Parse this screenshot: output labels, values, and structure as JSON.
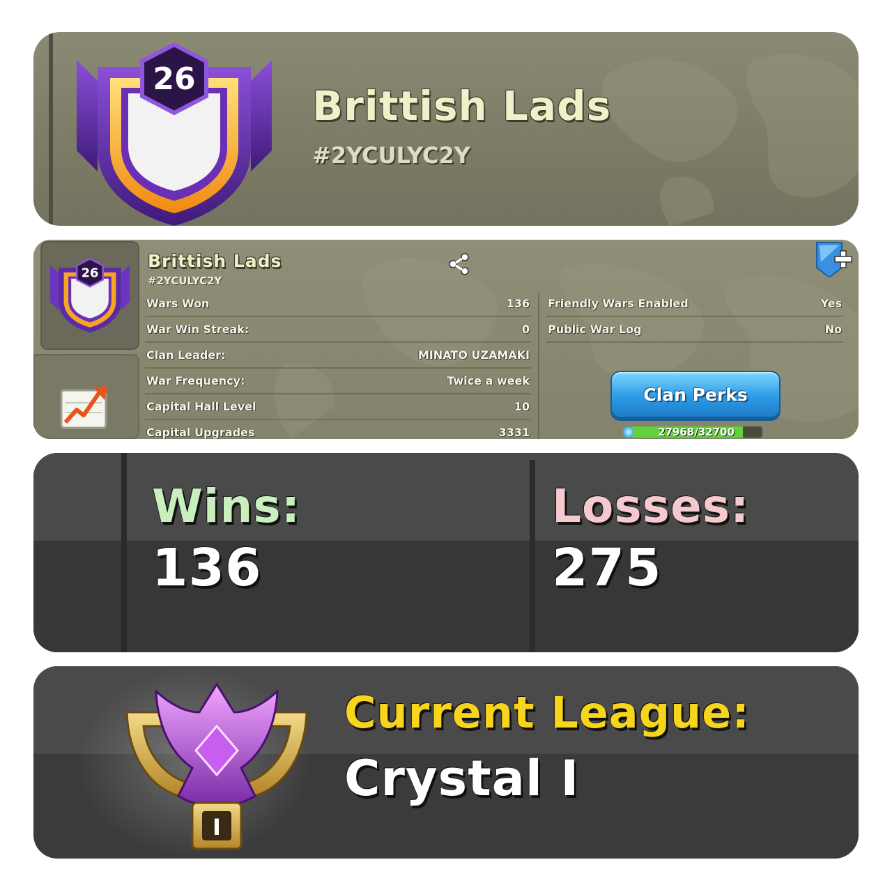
{
  "header": {
    "clan_level": "26",
    "clan_name": "Brittish Lads",
    "clan_tag": "#2YCULYC2Y"
  },
  "details": {
    "clan_level": "26",
    "clan_name": "Brittish Lads",
    "clan_tag": "#2YCULYC2Y",
    "left_rows": [
      {
        "label": "Wars Won",
        "value": "136"
      },
      {
        "label": "War Win Streak:",
        "value": "0"
      },
      {
        "label": "Clan Leader:",
        "value": "MINATO UZAMAKI"
      },
      {
        "label": "War Frequency:",
        "value": "Twice a week"
      },
      {
        "label": "Capital Hall Level",
        "value": "10"
      },
      {
        "label": "Capital Upgrades",
        "value": "3331"
      }
    ],
    "right_rows": [
      {
        "label": "Friendly Wars Enabled",
        "value": "Yes"
      },
      {
        "label": "Public War Log",
        "value": "No"
      }
    ],
    "perks_button_label": "Clan Perks",
    "xp_text": "27968/32700",
    "xp_progress": 0.855
  },
  "war_stats": {
    "wins_label": "Wins:",
    "wins_value": "136",
    "losses_label": "Losses:",
    "losses_value": "275"
  },
  "league": {
    "label": "Current League:",
    "value": "Crystal I",
    "tier_mark": "I"
  },
  "colors": {
    "wins": "#c9efbf",
    "losses": "#f5c9cd",
    "league_label": "#f6d51c",
    "perks_button": "#2d9be6"
  },
  "icons": [
    "clan-badge-icon",
    "share-icon",
    "add-flag-icon",
    "trend-chart-icon",
    "crystal-league-icon",
    "xp-gem-icon"
  ]
}
